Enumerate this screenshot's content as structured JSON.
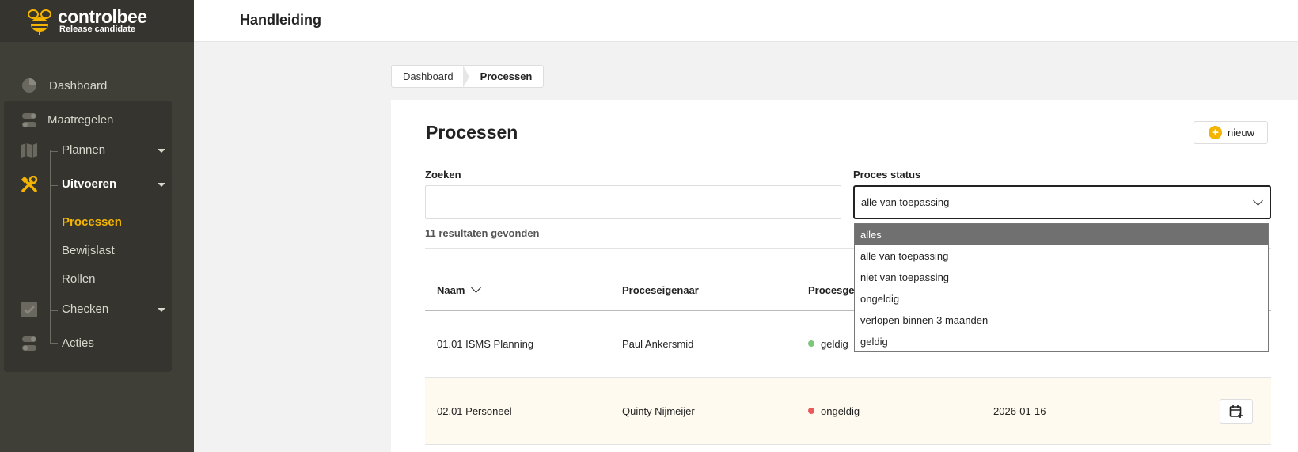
{
  "brand": {
    "name": "controlbee",
    "subtitle": "Release candidate"
  },
  "header": {
    "title": "Handleiding"
  },
  "sidebar": {
    "dashboard": {
      "label": "Dashboard",
      "icon": "pie-chart-icon"
    },
    "group": {
      "title": {
        "label": "Maatregelen",
        "icon": "toggle-icon"
      },
      "items": [
        {
          "label": "Plannen",
          "icon": "map-icon",
          "expandable": true
        },
        {
          "label": "Uitvoeren",
          "icon": "tools-icon",
          "expandable": true,
          "active": true,
          "children": [
            {
              "label": "Processen",
              "current": true
            },
            {
              "label": "Bewijslast"
            },
            {
              "label": "Rollen"
            }
          ]
        },
        {
          "label": "Checken",
          "icon": "checkbox-icon",
          "expandable": true
        },
        {
          "label": "Acties",
          "icon": "toggle-icon"
        }
      ]
    }
  },
  "breadcrumb": {
    "items": [
      "Dashboard",
      "Processen"
    ]
  },
  "page": {
    "title": "Processen",
    "new_button": "nieuw",
    "search": {
      "label": "Zoeken",
      "value": ""
    },
    "status_filter": {
      "label": "Proces status",
      "value": "alle van toepassing",
      "options": [
        "alles",
        "alle van toepassing",
        "niet van toepassing",
        "ongeldig",
        "verlopen binnen 3 maanden",
        "geldig"
      ],
      "highlighted": "alles"
    },
    "results_text": "11 resultaten gevonden",
    "table": {
      "columns": [
        "Naam",
        "Proceseigenaar",
        "Procesge"
      ],
      "rows": [
        {
          "name": "01.01 ISMS Planning",
          "owner": "Paul Ankersmid",
          "status": "geldig",
          "status_color": "#7dc67a",
          "date": ""
        },
        {
          "name": "02.01 Personeel",
          "owner": "Quinty Nijmeijer",
          "status": "ongeldig",
          "status_color": "#e95a5a",
          "date": "2026-01-16"
        }
      ]
    }
  },
  "colors": {
    "accent": "#f5b400",
    "sidebar_bg": "#3f3e37"
  }
}
